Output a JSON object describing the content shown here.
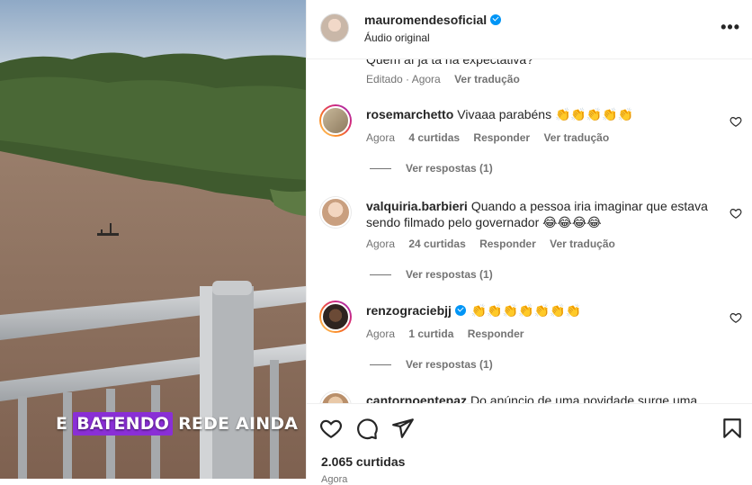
{
  "video": {
    "caption_pre": "E",
    "caption_highlight": "BATENDO",
    "caption_post": "REDE AINDA",
    "highlight_color": "#8a2fd6"
  },
  "header": {
    "username": "mauromendesoficial",
    "audio": "Áudio original",
    "more_icon": "more-horizontal-icon"
  },
  "previous_comment": {
    "text": "Quem aí já tá na expectativa?",
    "edited": "Editado · Agora",
    "translate": "Ver tradução"
  },
  "comments": [
    {
      "user": "rosemarchetto",
      "text": "Vivaaa parabéns 👏👏👏👏👏",
      "time": "Agora",
      "likes": "4 curtidas",
      "reply": "Responder",
      "translate": "Ver tradução",
      "replies": "Ver respostas (1)"
    },
    {
      "user": "valquiria.barbieri",
      "text": "Quando a pessoa iria imaginar que estava sendo filmado pelo governador 😂😂😂😂",
      "time": "Agora",
      "likes": "24 curtidas",
      "reply": "Responder",
      "translate": "Ver tradução",
      "replies": "Ver respostas (1)"
    },
    {
      "user": "renzograciebjj",
      "text": "👏👏👏👏👏👏👏",
      "time": "Agora",
      "likes": "1 curtida",
      "reply": "Responder",
      "replies": "Ver respostas (1)"
    },
    {
      "user": "cantornoentepaz",
      "text": "Do anúncio de uma novidade surge uma"
    }
  ],
  "actions": {
    "likes": "2.065 curtidas",
    "time": "Agora",
    "icons": [
      "heart-icon",
      "comment-icon",
      "share-icon",
      "bookmark-icon"
    ]
  }
}
